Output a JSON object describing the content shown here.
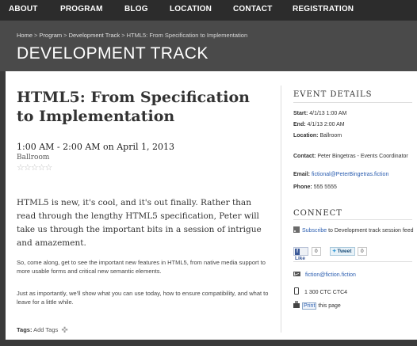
{
  "nav": [
    "ABOUT",
    "PROGRAM",
    "BLOG",
    "LOCATION",
    "CONTACT",
    "REGISTRATION"
  ],
  "breadcrumb": [
    "Home",
    "Program",
    "Development Track",
    "HTML5: From Specification to Implementation"
  ],
  "breadcrumb_sep": ">",
  "page_title": "DEVELOPMENT TRACK",
  "event": {
    "title": "HTML5: From Specification to Implementation",
    "when": "1:00 AM - 2:00 AM on April 1, 2013",
    "venue": "Ballroom",
    "rating_stars": "☆☆☆☆☆",
    "rating_value": 0,
    "rating_max": 5,
    "lead": "HTML5 is new, it's cool, and it's out finally. Rather than read through the lengthy HTML5 specification, Peter will take us through the important bits in a session of intrigue and amazement.",
    "para1": "So, come along, get to see the important new features in HTML5, from native media support to more usable forms and critical new semantic elements.",
    "para2": "Just as importantly, we'll show what you can use today, how to ensure compatibility, and what to leave for a little while.",
    "tags_label": "Tags:",
    "add_tags": "Add Tags"
  },
  "sidebar": {
    "details_heading": "EVENT DETAILS",
    "start_label": "Start:",
    "start_value": "4/1/13 1:00 AM",
    "end_label": "End:",
    "end_value": "4/1/13 2:00 AM",
    "location_label": "Location:",
    "location_value": "Ballroom",
    "contact_label": "Contact:",
    "contact_value": "Peter Bingetras - Events Coordinator",
    "email_label": "Email:",
    "email_value": "fictional@PeterBingetras.fiction",
    "phone_label": "Phone:",
    "phone_value": "555 5555",
    "connect_heading": "CONNECT",
    "subscribe_link": "Subscribe",
    "subscribe_rest": " to Development track session feed",
    "like_label": "Like",
    "like_count": "0",
    "tweet_label": "Tweet",
    "tweet_count": "0",
    "mail": "fiction@fiction.fiction",
    "phone_line": "1 300 CTC CTC4",
    "print_label": "Print",
    "print_rest": " this page"
  },
  "colors": {
    "nav_bg": "#2c2c2c",
    "hero_bg": "#4a4a4a",
    "link": "#2a5db0"
  },
  "icons": [
    "rss-icon",
    "facebook-icon",
    "twitter-icon",
    "envelope-icon",
    "phone-icon",
    "printer-icon",
    "plus-icon"
  ]
}
